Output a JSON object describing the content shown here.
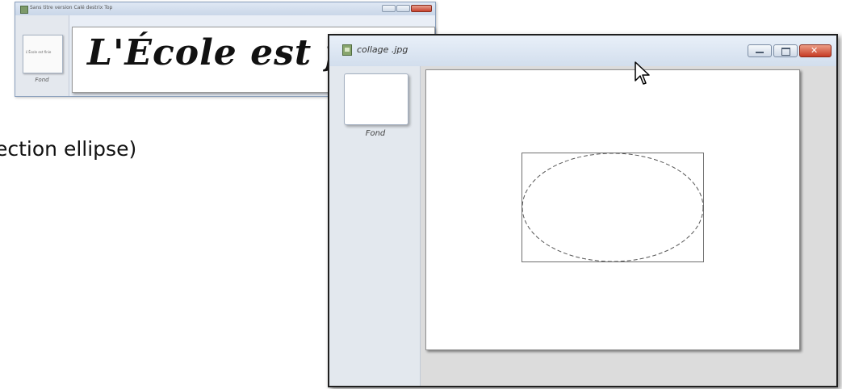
{
  "background_window": {
    "title": "Sans titre version Calé destrix Top",
    "thumbnail_text": "L'École est finie",
    "thumbnail_label": "Fond",
    "headline": "L'École est f"
  },
  "slide_text": "ection ellipse)",
  "window": {
    "title": "collage .jpg",
    "controls": {
      "minimize": "minimize-icon",
      "maximize": "maximize-icon",
      "close": "close-icon"
    },
    "layers": [
      {
        "label": "Fond"
      }
    ],
    "canvas": {
      "selection_shape": "ellipse",
      "selection_style": "dashed"
    }
  },
  "colors": {
    "close_button": "#c63a24",
    "titlebar": "#d2deed",
    "workspace": "#dcdcdc"
  }
}
